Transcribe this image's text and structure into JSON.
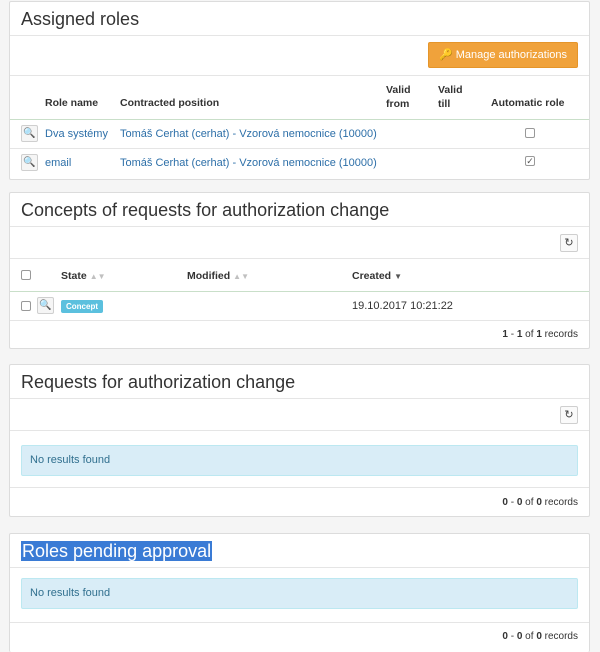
{
  "assigned": {
    "title": "Assigned roles",
    "manage_icon": "key-icon",
    "manage_label": "Manage authorizations",
    "columns": {
      "role_name": "Role name",
      "contracted_position": "Contracted position",
      "valid_from_1": "Valid",
      "valid_from_2": "from",
      "valid_till_1": "Valid",
      "valid_till_2": "till",
      "automatic_role": "Automatic role"
    },
    "rows": [
      {
        "role": "Dva systémy",
        "position": "Tomáš Cerhat (cerhat) - Vzorová nemocnice (10000)",
        "automatic": false
      },
      {
        "role": "email",
        "position": "Tomáš Cerhat (cerhat) - Vzorová nemocnice (10000)",
        "automatic": true
      }
    ]
  },
  "concepts": {
    "title": "Concepts of requests for authorization change",
    "columns": {
      "state": "State",
      "modified": "Modified",
      "created": "Created"
    },
    "rows": [
      {
        "state": "Concept",
        "modified": "",
        "created": "19.10.2017 10:21:22"
      }
    ],
    "footer": {
      "from": "1",
      "sep1": " - ",
      "to": "1",
      "of": " of ",
      "total": "1",
      "records": " records"
    }
  },
  "requests": {
    "title": "Requests for authorization change",
    "empty": "No results found",
    "footer": {
      "from": "0",
      "sep1": " - ",
      "to": "0",
      "of": " of ",
      "total": "0",
      "records": " records"
    }
  },
  "pending": {
    "title": "Roles pending approval",
    "empty": "No results found",
    "footer": {
      "from": "0",
      "sep1": " - ",
      "to": "0",
      "of": " of ",
      "total": "0",
      "records": " records"
    }
  },
  "colors": {
    "accent": "#f0a23b",
    "link": "#2d6fa8",
    "badge": "#5bc0de",
    "selection": "#3a7bd5"
  }
}
